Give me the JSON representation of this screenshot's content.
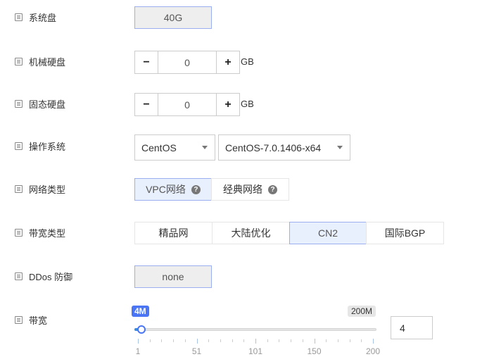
{
  "rows": {
    "system_disk": {
      "label": "系统盘",
      "value": "40G"
    },
    "hdd": {
      "label": "机械硬盘",
      "value": "0",
      "minus": "−",
      "plus": "+",
      "unit": "GB"
    },
    "ssd": {
      "label": "固态硬盘",
      "value": "0",
      "minus": "−",
      "plus": "+",
      "unit": "GB"
    },
    "os": {
      "label": "操作系统",
      "type": "CentOS",
      "version": "CentOS-7.0.1406-x64"
    },
    "network": {
      "label": "网络类型",
      "options": [
        "VPC网络",
        "经典网络"
      ],
      "selected": 0,
      "help": "?"
    },
    "bandwidth_type": {
      "label": "带宽类型",
      "options": [
        "精品网",
        "大陆优化",
        "CN2",
        "国际BGP"
      ],
      "selected": 2
    },
    "ddos": {
      "label": "DDos 防御",
      "value": "none"
    },
    "bandwidth": {
      "label": "带宽",
      "current_badge": "4M",
      "max_badge": "200M",
      "value": "4",
      "min": 1,
      "max": 200,
      "tick_labels": [
        "1",
        "51",
        "101",
        "150",
        "200"
      ]
    }
  },
  "colors": {
    "accent": "#4a76f6",
    "selected_bg": "#e8effd",
    "selected_border": "#9aaef0"
  }
}
